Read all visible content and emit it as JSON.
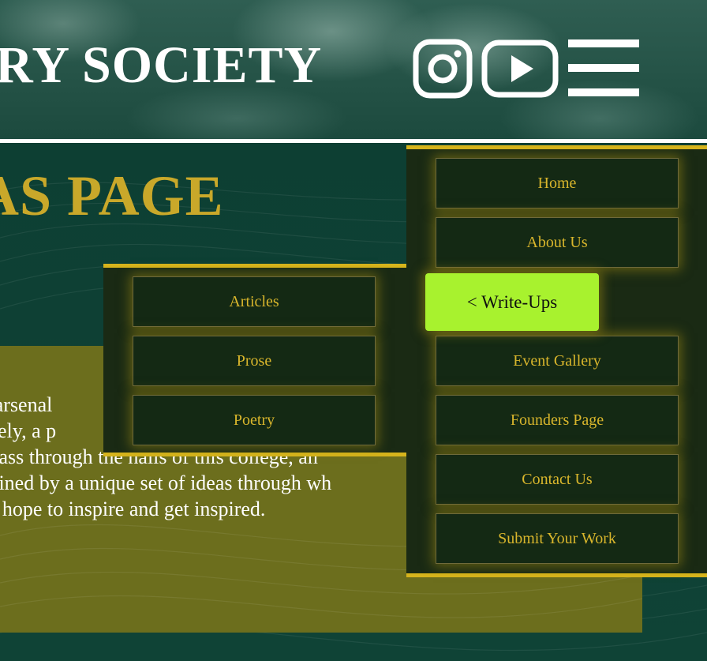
{
  "header": {
    "site_title": "RY SOCIETY",
    "icons": [
      "instagram-icon",
      "youtube-icon",
      "hamburger-menu-icon"
    ]
  },
  "main": {
    "page_heading": "AS PAGE",
    "intro_lines": [
      "tSoc arsenal",
      "es freely, a p",
      "that pass through the halls of this college, an",
      "et defined by a unique set of ideas through wh",
      "n, we hope to inspire and get inspired."
    ]
  },
  "submenu": {
    "items": [
      "Articles",
      "Prose",
      "Poetry"
    ]
  },
  "nav": {
    "items": [
      "Home",
      "About Us",
      "< Write-Ups",
      "Event Gallery",
      "Founders Page",
      "Contact Us",
      "Submit Your Work"
    ],
    "active_index": 2
  },
  "colors": {
    "accent_gold": "#d6b41c",
    "menu_text": "#d9b62c",
    "active_bg": "#a8f22e",
    "menu_bg": "#1a2a14",
    "olive_panel": "#6c6e1d",
    "page_bg": "#0f3f33"
  }
}
